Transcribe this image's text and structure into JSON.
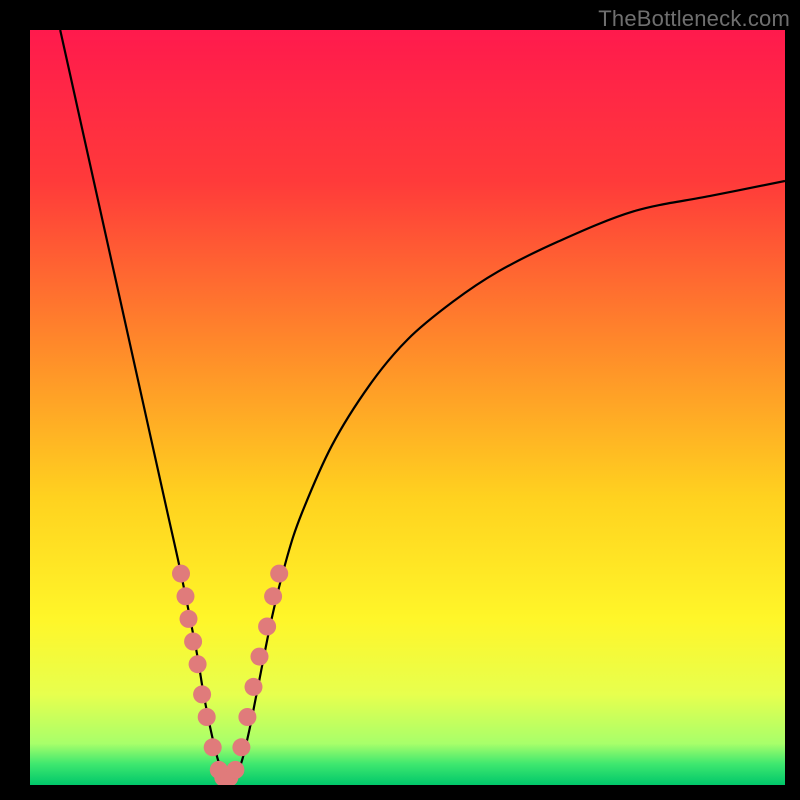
{
  "watermark": "TheBottleneck.com",
  "chart_data": {
    "type": "line",
    "title": "",
    "xlabel": "",
    "ylabel": "",
    "xlim": [
      0,
      100
    ],
    "ylim": [
      0,
      100
    ],
    "background_gradient_stops": [
      {
        "offset": 0.0,
        "color": "#ff1a4d"
      },
      {
        "offset": 0.2,
        "color": "#ff3a3a"
      },
      {
        "offset": 0.42,
        "color": "#ff8a2a"
      },
      {
        "offset": 0.62,
        "color": "#ffd21f"
      },
      {
        "offset": 0.78,
        "color": "#fff629"
      },
      {
        "offset": 0.88,
        "color": "#e7ff4e"
      },
      {
        "offset": 0.945,
        "color": "#a8ff6a"
      },
      {
        "offset": 0.972,
        "color": "#3fe86f"
      },
      {
        "offset": 1.0,
        "color": "#00c76a"
      }
    ],
    "series": [
      {
        "name": "bottleneck-curve",
        "color": "#000000",
        "x": [
          4,
          6,
          8,
          10,
          12,
          14,
          16,
          18,
          20,
          22,
          23,
          24,
          25,
          26,
          27,
          28,
          29,
          30,
          32,
          34,
          36,
          40,
          45,
          50,
          56,
          62,
          70,
          80,
          90,
          100
        ],
        "y": [
          100,
          91,
          82,
          73,
          64,
          55,
          46,
          37,
          28,
          18,
          12,
          7,
          3,
          1,
          1,
          3,
          7,
          12,
          22,
          30,
          36,
          45,
          53,
          59,
          64,
          68,
          72,
          76,
          78,
          80
        ]
      }
    ],
    "markers": {
      "name": "highlight-dots",
      "color": "#e07b7b",
      "radius_px": 9,
      "points": [
        {
          "x": 20.0,
          "y": 28
        },
        {
          "x": 20.6,
          "y": 25
        },
        {
          "x": 21.0,
          "y": 22
        },
        {
          "x": 21.6,
          "y": 19
        },
        {
          "x": 22.2,
          "y": 16
        },
        {
          "x": 22.8,
          "y": 12
        },
        {
          "x": 23.4,
          "y": 9
        },
        {
          "x": 24.2,
          "y": 5
        },
        {
          "x": 25.0,
          "y": 2
        },
        {
          "x": 25.6,
          "y": 1
        },
        {
          "x": 26.4,
          "y": 1
        },
        {
          "x": 27.2,
          "y": 2
        },
        {
          "x": 28.0,
          "y": 5
        },
        {
          "x": 28.8,
          "y": 9
        },
        {
          "x": 29.6,
          "y": 13
        },
        {
          "x": 30.4,
          "y": 17
        },
        {
          "x": 31.4,
          "y": 21
        },
        {
          "x": 32.2,
          "y": 25
        },
        {
          "x": 33.0,
          "y": 28
        }
      ]
    }
  }
}
